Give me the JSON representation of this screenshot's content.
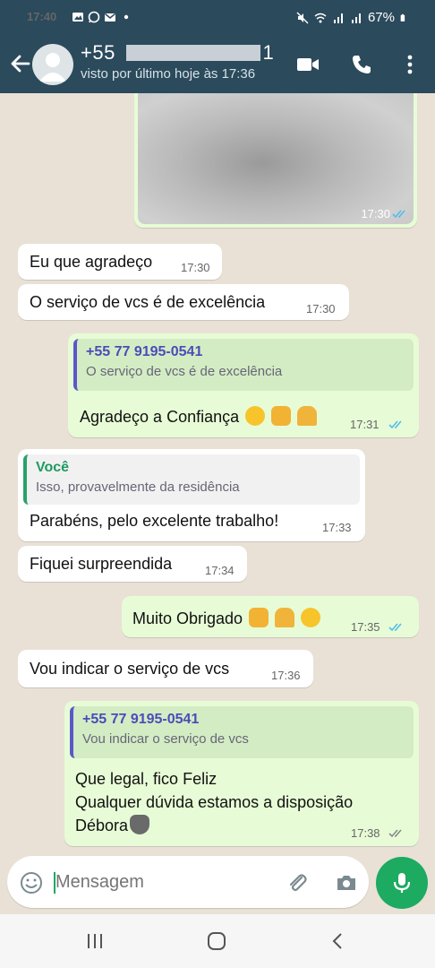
{
  "status_bar": {
    "time": "17:40",
    "battery": "67%"
  },
  "header": {
    "contact_name": "+55 77 ██████ ████",
    "contact_name_visible": "+55",
    "contact_name_tail": "1",
    "last_seen": "visto por último hoje às 17:36"
  },
  "messages": [
    {
      "id": "m0",
      "direction": "out",
      "type": "image",
      "time": "17:30"
    },
    {
      "id": "m1",
      "direction": "in",
      "text": "Eu que agradeço",
      "time": "17:30"
    },
    {
      "id": "m2",
      "direction": "in",
      "text": "O serviço de vcs é de excelência",
      "time": "17:30"
    },
    {
      "id": "m3",
      "direction": "out",
      "quote_name": "+55 77 9195-0541",
      "quote_text": "O serviço de vcs é de excelência",
      "text": "Agradeço a Confiança",
      "time": "17:31"
    },
    {
      "id": "m4",
      "direction": "in",
      "quote_name": "Você",
      "quote_text": "Isso, provavelmente da residência",
      "text": "Parabéns, pelo excelente trabalho!",
      "time": "17:33"
    },
    {
      "id": "m5",
      "direction": "in",
      "text": "Fiquei surpreendida",
      "time": "17:34"
    },
    {
      "id": "m6",
      "direction": "out",
      "text": "Muito Obrigado",
      "time": "17:35"
    },
    {
      "id": "m7",
      "direction": "in",
      "text": "Vou indicar o serviço de vcs",
      "time": "17:36"
    },
    {
      "id": "m8",
      "direction": "out",
      "quote_name": "+55 77 9195-0541",
      "quote_text": "Vou indicar o serviço de vcs",
      "line1": "Que legal, fico Feliz",
      "line2": "Qualquer dúvida estamos a disposição",
      "line3": "Débora",
      "time": "17:38"
    }
  ],
  "composer": {
    "placeholder": "Mensagem"
  },
  "colors": {
    "header": "#2b4a5c",
    "outgoing": "#e7fcd6",
    "incoming": "#ffffff",
    "read_ticks": "#53bdeb",
    "mic": "#1daa61",
    "chat_bg": "#e9e1d6"
  }
}
